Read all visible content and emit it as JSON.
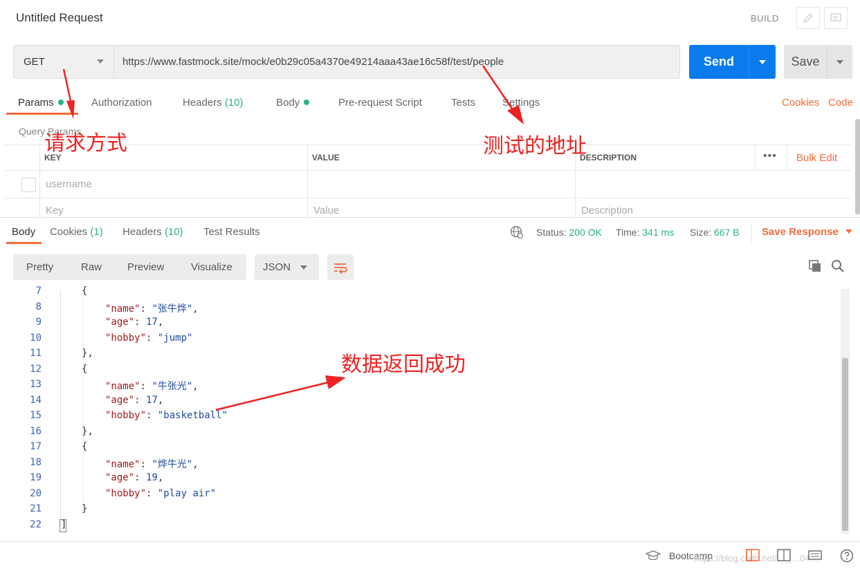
{
  "header": {
    "title": "Untitled Request",
    "build_label": "BUILD",
    "edit_icon": "pencil-icon",
    "comments_icon": "comments-icon"
  },
  "request": {
    "method": "GET",
    "url": "https://www.fastmock.site/mock/e0b29c05a4370e49214aaa43ae16c58f/test/people",
    "send_label": "Send",
    "save_label": "Save"
  },
  "request_tabs": [
    {
      "label": "Params",
      "dot": true
    },
    {
      "label": "Authorization"
    },
    {
      "label": "Headers",
      "count": "(10)"
    },
    {
      "label": "Body",
      "dot": true
    },
    {
      "label": "Pre-request Script"
    },
    {
      "label": "Tests"
    },
    {
      "label": "Settings"
    }
  ],
  "request_links": {
    "cookies": "Cookies",
    "code": "Code"
  },
  "query_params": {
    "title": "Query Params",
    "columns": [
      "KEY",
      "VALUE",
      "DESCRIPTION"
    ],
    "bulk_edit": "Bulk Edit",
    "more": "•••",
    "row1_key": "username",
    "placeholder_key": "Key",
    "placeholder_value": "Value",
    "placeholder_description": "Description"
  },
  "response_tabs": [
    {
      "label": "Body"
    },
    {
      "label": "Cookies",
      "count": "(1)"
    },
    {
      "label": "Headers",
      "count": "(10)"
    },
    {
      "label": "Test Results"
    }
  ],
  "status": {
    "status_label": "Status:",
    "status_value": "200 OK",
    "time_label": "Time:",
    "time_value": "341 ms",
    "size_label": "Size:",
    "size_value": "667 B",
    "save_response": "Save Response"
  },
  "view": {
    "tabs": [
      "Pretty",
      "Raw",
      "Preview",
      "Visualize"
    ],
    "format": "JSON"
  },
  "code_lines": [
    {
      "n": "7",
      "t": "{"
    },
    {
      "n": "8",
      "indent": 2,
      "key": "\"name\"",
      "val": "\"张牛烨\"",
      "tail": ","
    },
    {
      "n": "9",
      "indent": 2,
      "key": "\"age\"",
      "num": "17",
      "tail": ","
    },
    {
      "n": "10",
      "indent": 2,
      "key": "\"hobby\"",
      "val": "\"jump\""
    },
    {
      "n": "11",
      "t": "},"
    },
    {
      "n": "12",
      "t": "{"
    },
    {
      "n": "13",
      "indent": 2,
      "key": "\"name\"",
      "val": "\"牛张光\"",
      "tail": ","
    },
    {
      "n": "14",
      "indent": 2,
      "key": "\"age\"",
      "num": "17",
      "tail": ","
    },
    {
      "n": "15",
      "indent": 2,
      "key": "\"hobby\"",
      "val": "\"basketball\""
    },
    {
      "n": "16",
      "t": "},"
    },
    {
      "n": "17",
      "t": "{"
    },
    {
      "n": "18",
      "indent": 2,
      "key": "\"name\"",
      "val": "\"烨牛光\"",
      "tail": ","
    },
    {
      "n": "19",
      "indent": 2,
      "key": "\"age\"",
      "num": "19",
      "tail": ","
    },
    {
      "n": "20",
      "indent": 2,
      "key": "\"hobby\"",
      "val": "\"play air\""
    },
    {
      "n": "21",
      "t": "}"
    },
    {
      "n": "22",
      "t": "]",
      "root": true
    }
  ],
  "footer": {
    "bootcamp": "Bootcamp",
    "watermark": "https://blog.csdn.net/…_…04…"
  },
  "annotations": {
    "method_note": "请求方式",
    "url_note": "测试的地址",
    "data_note": "数据返回成功",
    "color": "#ee2222"
  },
  "colors": {
    "send_blue": "#097bed",
    "accent_orange": "#f26b3a",
    "success_green": "#26b47f"
  }
}
